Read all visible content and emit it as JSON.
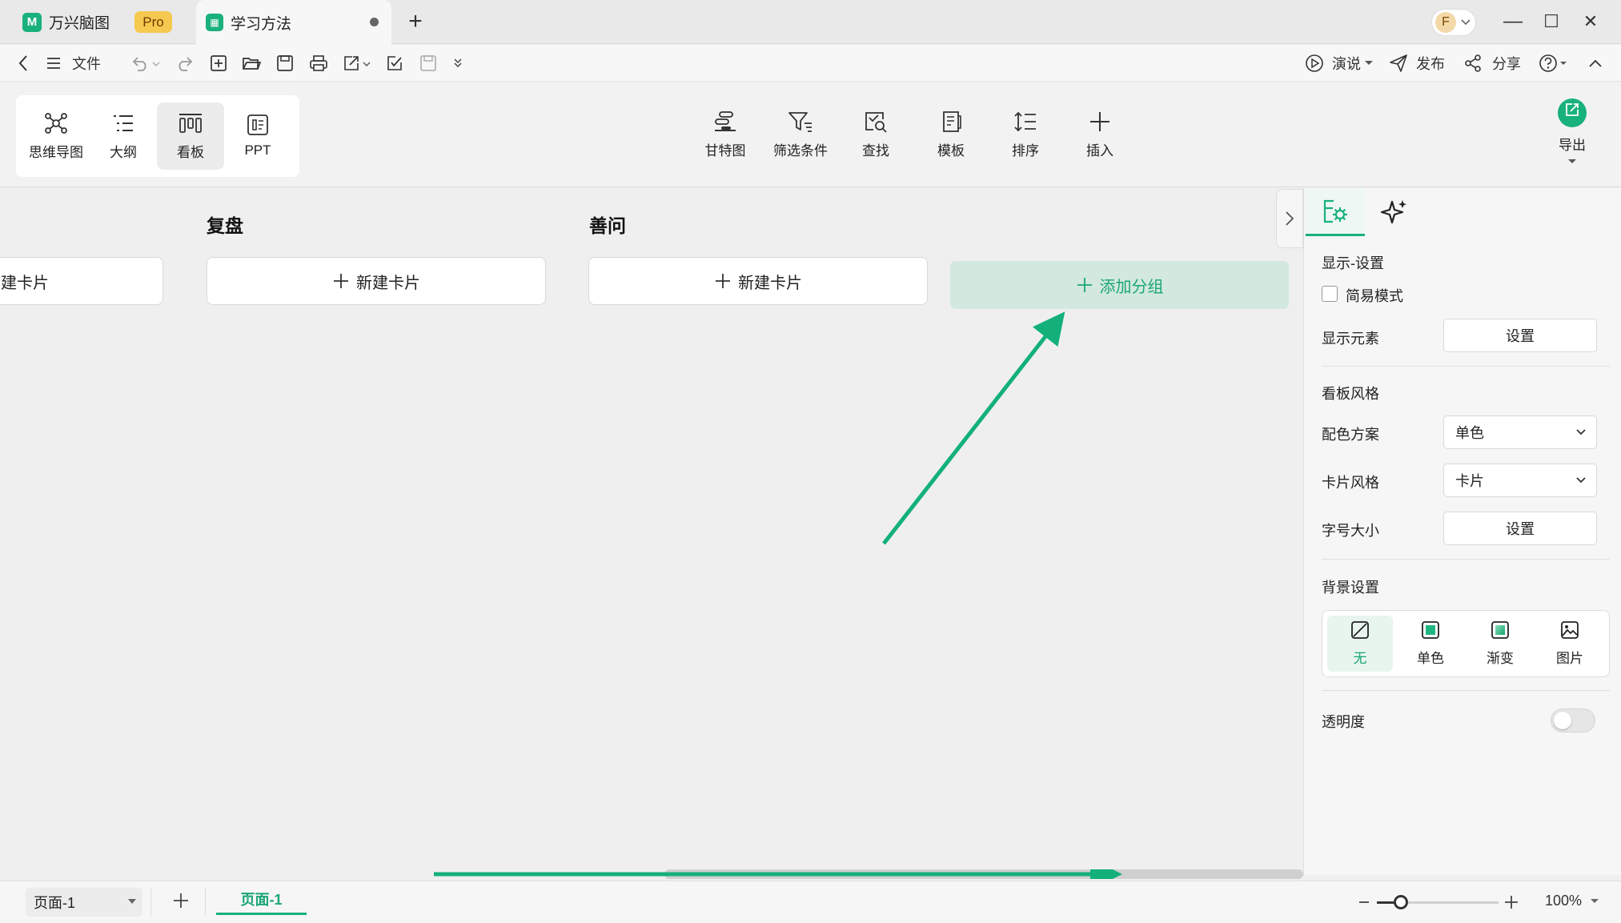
{
  "tabs": {
    "app_name": "万兴脑图",
    "pro_badge": "Pro",
    "doc_name": "学习方法"
  },
  "window_controls": {
    "minimize": "—",
    "maximize": "☐",
    "close": "✕"
  },
  "avatar_letter": "F",
  "menubar": {
    "file": "文件",
    "present": "演说",
    "publish": "发布",
    "share": "分享"
  },
  "views": [
    {
      "label": "思维导图",
      "icon": "mindmap-icon"
    },
    {
      "label": "大纲",
      "icon": "outline-icon"
    },
    {
      "label": "看板",
      "icon": "kanban-icon",
      "selected": true
    },
    {
      "label": "PPT",
      "icon": "ppt-icon"
    }
  ],
  "tools": [
    {
      "label": "甘特图",
      "icon": "gantt-icon"
    },
    {
      "label": "筛选条件",
      "icon": "filter-icon"
    },
    {
      "label": "查找",
      "icon": "find-icon"
    },
    {
      "label": "模板",
      "icon": "template-icon"
    },
    {
      "label": "排序",
      "icon": "sort-icon"
    },
    {
      "label": "插入",
      "icon": "insert-icon"
    }
  ],
  "export_label": "导出",
  "board": {
    "partial_card": "建卡片",
    "columns": [
      {
        "title": "复盘",
        "new_card": "新建卡片"
      },
      {
        "title": "善问",
        "new_card": "新建卡片"
      }
    ],
    "add_group": "添加分组"
  },
  "panel": {
    "display_section": "显示-设置",
    "simple_mode": "简易模式",
    "show_elements": "显示元素",
    "settings_btn": "设置",
    "board_style": "看板风格",
    "color_scheme": "配色方案",
    "color_scheme_value": "单色",
    "card_style": "卡片风格",
    "card_style_value": "卡片",
    "font_size": "字号大小",
    "font_size_btn": "设置",
    "bg_settings": "背景设置",
    "bg_options": [
      {
        "label": "无",
        "selected": true
      },
      {
        "label": "单色"
      },
      {
        "label": "渐变"
      },
      {
        "label": "图片"
      }
    ],
    "opacity": "透明度"
  },
  "status": {
    "page_select": "页面-1",
    "page_tab": "页面-1",
    "zoom": "100%",
    "zoom_level": 0.2
  },
  "colors": {
    "accent": "#19b17c",
    "arrow": "#13b07a"
  }
}
